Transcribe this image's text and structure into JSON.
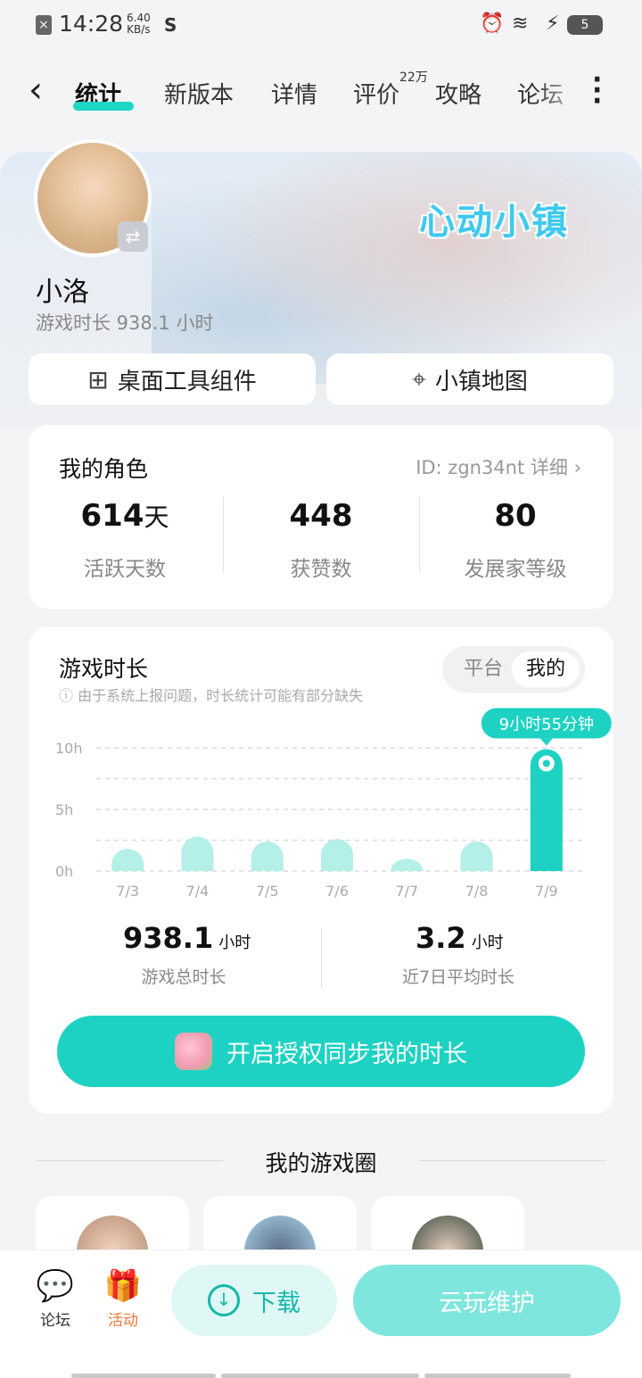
{
  "status_bar": {
    "time": "14:28",
    "speed_value": "6.40",
    "speed_unit": "KB/s",
    "battery": "5"
  },
  "nav": {
    "tabs": [
      "统计",
      "新版本",
      "详情",
      "评价",
      "攻略",
      "论坛"
    ],
    "active_tab": "统计",
    "review_badge": "22万"
  },
  "profile": {
    "game_logo": "心动小镇",
    "username": "小洛",
    "playtime": "游戏时长 938.1 小时",
    "buttons": {
      "widget": "桌面工具组件",
      "map": "小镇地图"
    }
  },
  "role": {
    "title": "我的角色",
    "id_link": "ID: zgn34nt 详细",
    "stats": [
      {
        "value": "614",
        "unit": "天",
        "label": "活跃天数"
      },
      {
        "value": "448",
        "unit": "",
        "label": "获赞数"
      },
      {
        "value": "80",
        "unit": "",
        "label": "发展家等级"
      }
    ]
  },
  "playtime_card": {
    "title": "游戏时长",
    "toggle": {
      "platform": "平台",
      "mine": "我的",
      "selected": "我的"
    },
    "note": "由于系统上报问题，时长统计可能有部分缺失",
    "total_value": "938.1",
    "total_unit": "小时",
    "total_label": "游戏总时长",
    "avg_value": "3.2",
    "avg_unit": "小时",
    "avg_label": "近7日平均时长",
    "cta": "开启授权同步我的时长"
  },
  "chart_data": {
    "type": "bar",
    "categories": [
      "7/3",
      "7/4",
      "7/5",
      "7/6",
      "7/7",
      "7/8",
      "7/9"
    ],
    "values": [
      1.8,
      2.8,
      2.4,
      2.6,
      1.0,
      2.4,
      9.9
    ],
    "ylim": [
      0,
      10
    ],
    "y_ticks": [
      "10h",
      "5h",
      "0h"
    ],
    "highlight_index": 6,
    "highlight_label": "9小时55分钟",
    "grid": true,
    "colors": {
      "bar": "#b4efe8",
      "highlight": "#1dd2c2"
    }
  },
  "game_circle": {
    "title": "我的游戏圈"
  },
  "bottom_bar": {
    "forum": "论坛",
    "activity": "活动",
    "download": "下载",
    "cloud": "云玩维护"
  },
  "colors": {
    "accent": "#1dd2c2",
    "activity": "#f07a3b"
  }
}
